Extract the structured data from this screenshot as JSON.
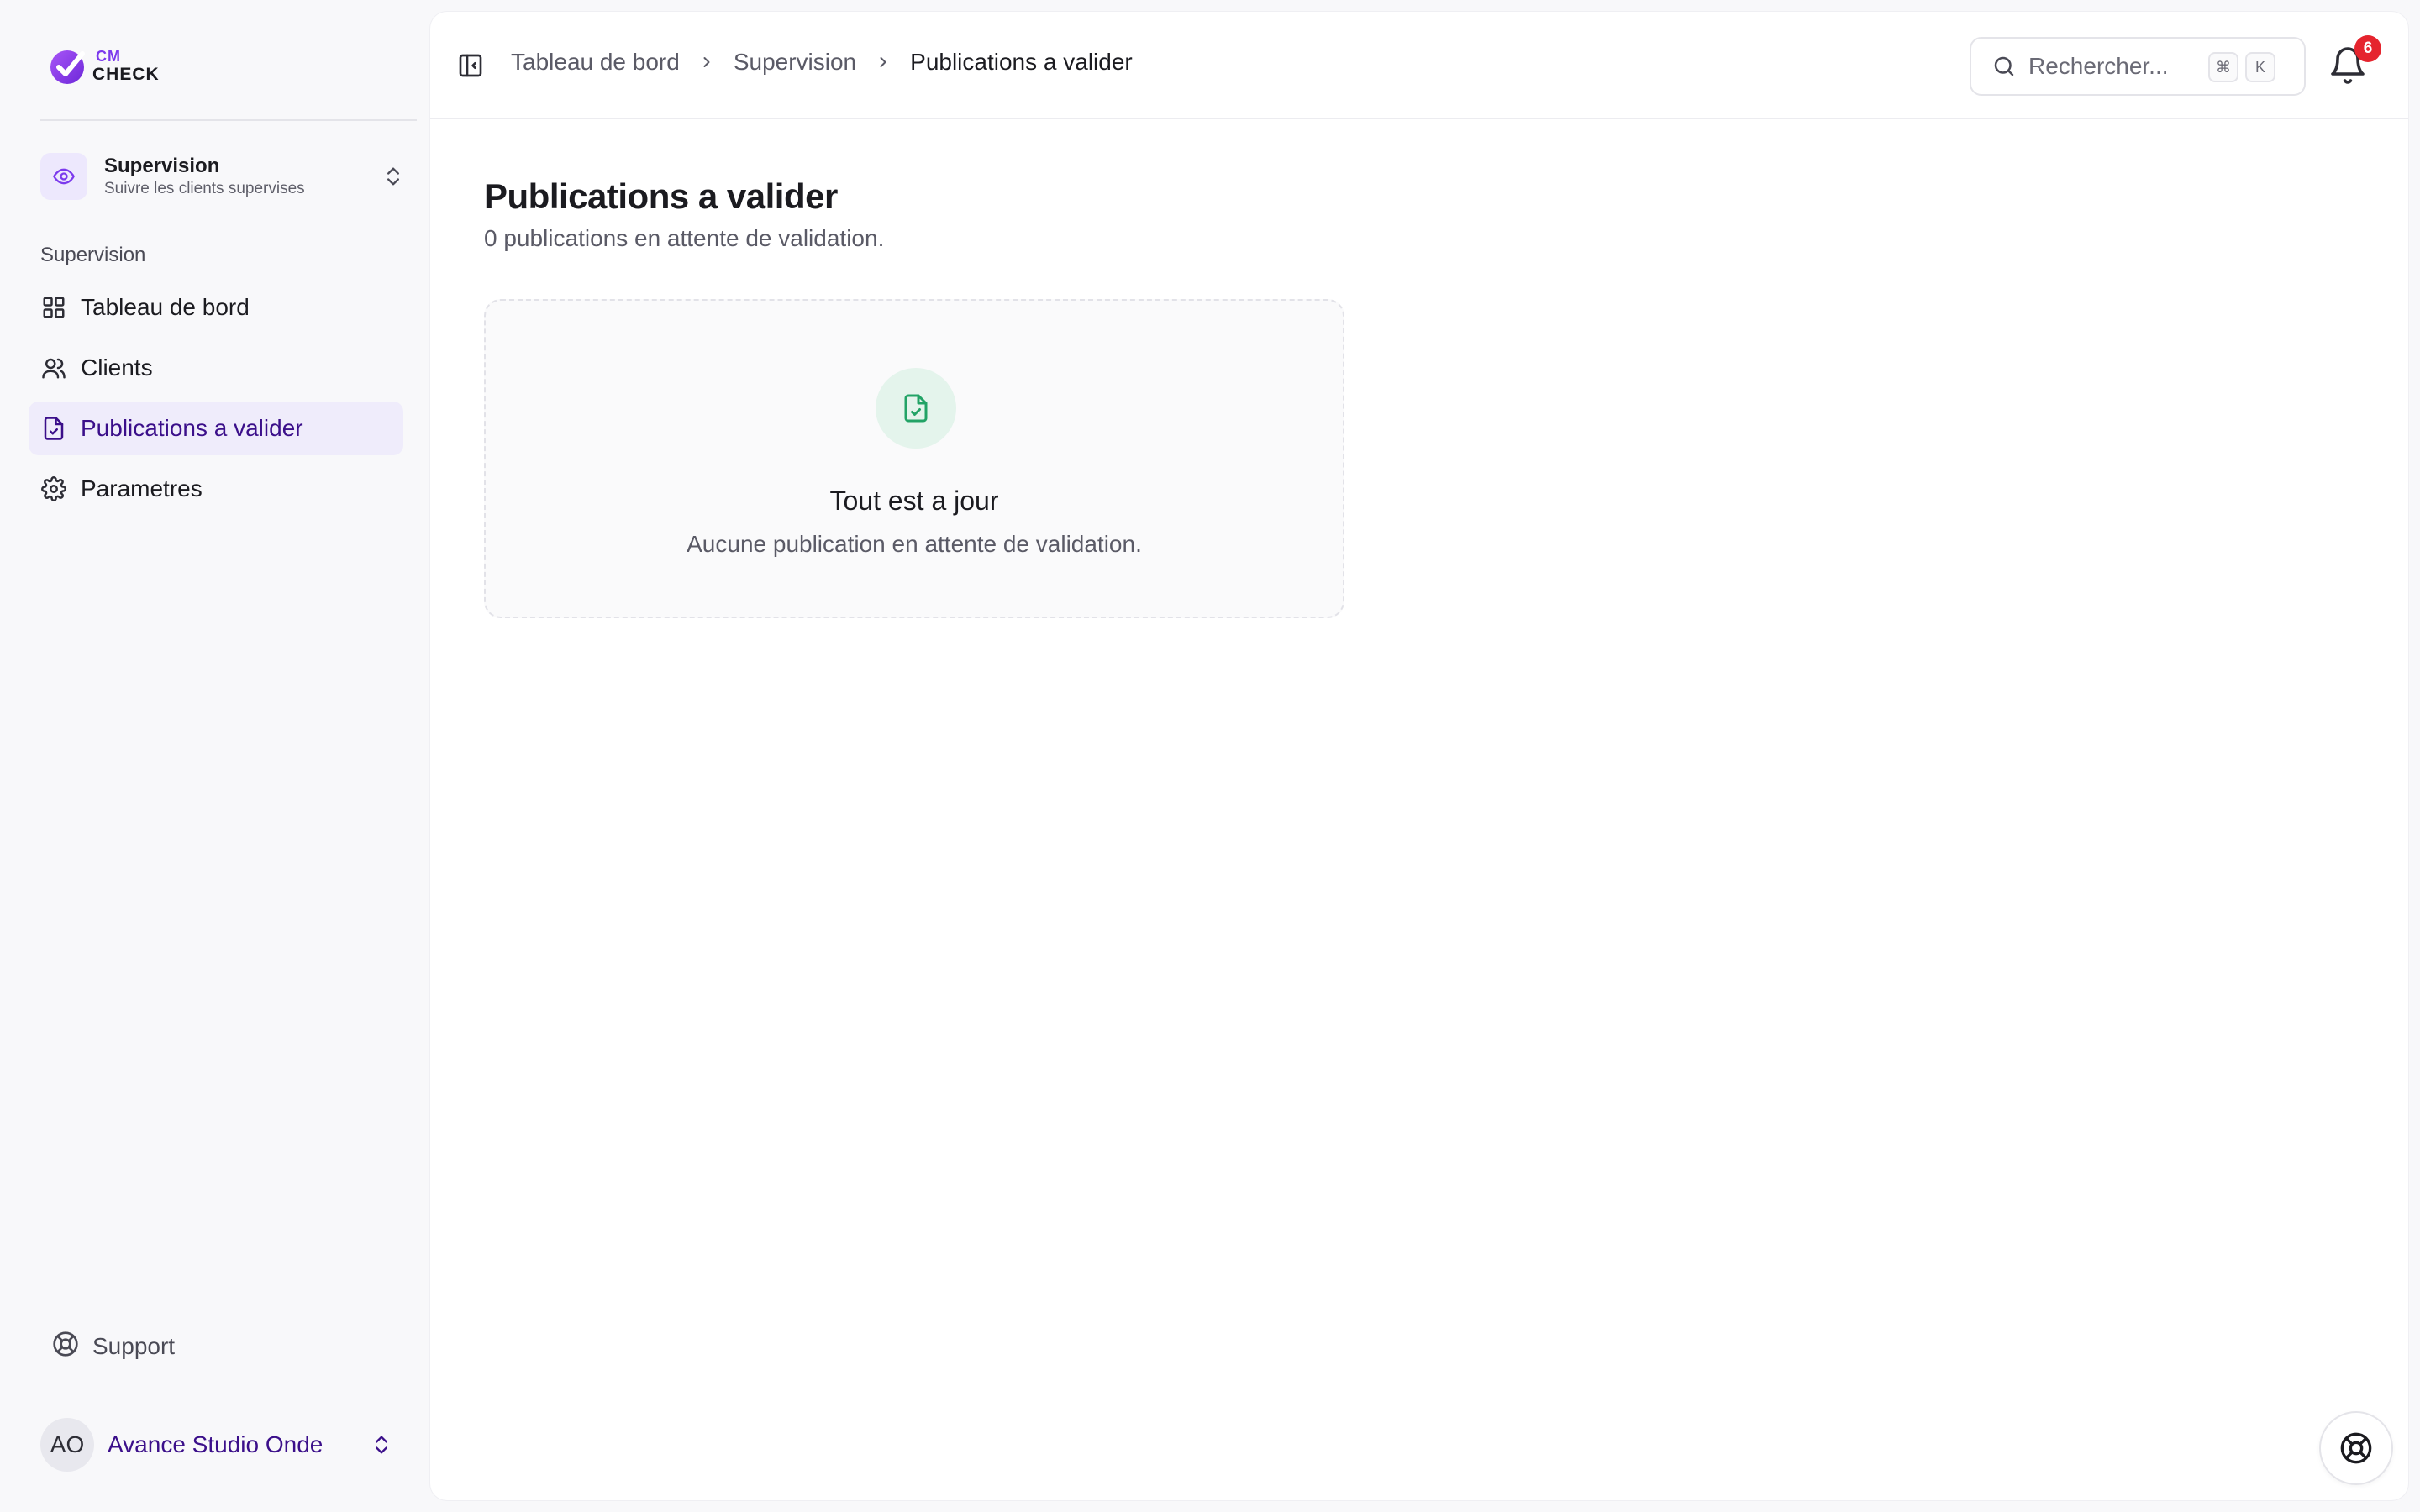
{
  "logo": {
    "line1": "CM",
    "line2": "CHECK"
  },
  "workspace": {
    "title": "Supervision",
    "subtitle": "Suivre les clients supervises"
  },
  "sidebar": {
    "section_label": "Supervision",
    "items": [
      {
        "label": "Tableau de bord",
        "icon": "grid-icon",
        "active": false
      },
      {
        "label": "Clients",
        "icon": "users-icon",
        "active": false
      },
      {
        "label": "Publications a valider",
        "icon": "file-check-icon",
        "active": true
      },
      {
        "label": "Parametres",
        "icon": "gear-icon",
        "active": false
      }
    ],
    "support_label": "Support",
    "user": {
      "initials": "AO",
      "name": "Avance Studio Onde"
    }
  },
  "topbar": {
    "breadcrumb": [
      "Tableau de bord",
      "Supervision",
      "Publications a valider"
    ],
    "search_placeholder": "Rechercher...",
    "shortcut": [
      "⌘",
      "K"
    ],
    "notification_count": "6"
  },
  "page": {
    "title": "Publications a valider",
    "subtitle": "0 publications en attente de validation."
  },
  "empty_state": {
    "title": "Tout est a jour",
    "description": "Aucune publication en attente de validation."
  },
  "colors": {
    "accent": "#7c3aed",
    "active_text": "#3b0f8a",
    "active_bg": "#efecfb",
    "success": "#22a366",
    "badge": "#e5242e"
  }
}
